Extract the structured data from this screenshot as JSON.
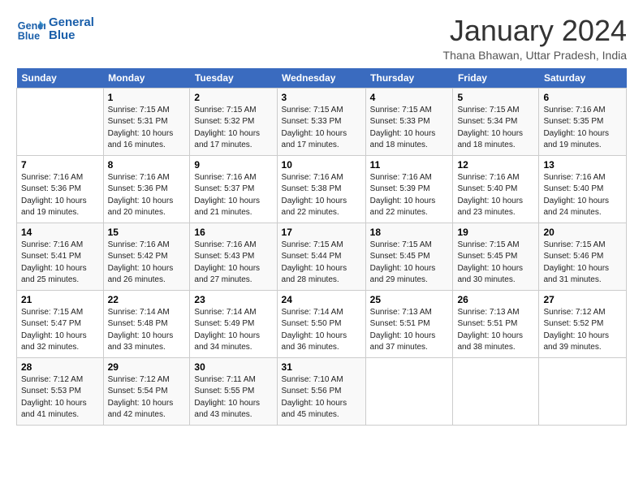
{
  "logo": {
    "line1": "General",
    "line2": "Blue"
  },
  "title": "January 2024",
  "subtitle": "Thana Bhawan, Uttar Pradesh, India",
  "header": {
    "days": [
      "Sunday",
      "Monday",
      "Tuesday",
      "Wednesday",
      "Thursday",
      "Friday",
      "Saturday"
    ]
  },
  "weeks": [
    [
      {
        "day": "",
        "sunrise": "",
        "sunset": "",
        "daylight": ""
      },
      {
        "day": "1",
        "sunrise": "7:15 AM",
        "sunset": "5:31 PM",
        "daylight": "10 hours and 16 minutes."
      },
      {
        "day": "2",
        "sunrise": "7:15 AM",
        "sunset": "5:32 PM",
        "daylight": "10 hours and 17 minutes."
      },
      {
        "day": "3",
        "sunrise": "7:15 AM",
        "sunset": "5:33 PM",
        "daylight": "10 hours and 17 minutes."
      },
      {
        "day": "4",
        "sunrise": "7:15 AM",
        "sunset": "5:33 PM",
        "daylight": "10 hours and 18 minutes."
      },
      {
        "day": "5",
        "sunrise": "7:15 AM",
        "sunset": "5:34 PM",
        "daylight": "10 hours and 18 minutes."
      },
      {
        "day": "6",
        "sunrise": "7:16 AM",
        "sunset": "5:35 PM",
        "daylight": "10 hours and 19 minutes."
      }
    ],
    [
      {
        "day": "7",
        "sunrise": "7:16 AM",
        "sunset": "5:36 PM",
        "daylight": "10 hours and 19 minutes."
      },
      {
        "day": "8",
        "sunrise": "7:16 AM",
        "sunset": "5:36 PM",
        "daylight": "10 hours and 20 minutes."
      },
      {
        "day": "9",
        "sunrise": "7:16 AM",
        "sunset": "5:37 PM",
        "daylight": "10 hours and 21 minutes."
      },
      {
        "day": "10",
        "sunrise": "7:16 AM",
        "sunset": "5:38 PM",
        "daylight": "10 hours and 22 minutes."
      },
      {
        "day": "11",
        "sunrise": "7:16 AM",
        "sunset": "5:39 PM",
        "daylight": "10 hours and 22 minutes."
      },
      {
        "day": "12",
        "sunrise": "7:16 AM",
        "sunset": "5:40 PM",
        "daylight": "10 hours and 23 minutes."
      },
      {
        "day": "13",
        "sunrise": "7:16 AM",
        "sunset": "5:40 PM",
        "daylight": "10 hours and 24 minutes."
      }
    ],
    [
      {
        "day": "14",
        "sunrise": "7:16 AM",
        "sunset": "5:41 PM",
        "daylight": "10 hours and 25 minutes."
      },
      {
        "day": "15",
        "sunrise": "7:16 AM",
        "sunset": "5:42 PM",
        "daylight": "10 hours and 26 minutes."
      },
      {
        "day": "16",
        "sunrise": "7:16 AM",
        "sunset": "5:43 PM",
        "daylight": "10 hours and 27 minutes."
      },
      {
        "day": "17",
        "sunrise": "7:15 AM",
        "sunset": "5:44 PM",
        "daylight": "10 hours and 28 minutes."
      },
      {
        "day": "18",
        "sunrise": "7:15 AM",
        "sunset": "5:45 PM",
        "daylight": "10 hours and 29 minutes."
      },
      {
        "day": "19",
        "sunrise": "7:15 AM",
        "sunset": "5:45 PM",
        "daylight": "10 hours and 30 minutes."
      },
      {
        "day": "20",
        "sunrise": "7:15 AM",
        "sunset": "5:46 PM",
        "daylight": "10 hours and 31 minutes."
      }
    ],
    [
      {
        "day": "21",
        "sunrise": "7:15 AM",
        "sunset": "5:47 PM",
        "daylight": "10 hours and 32 minutes."
      },
      {
        "day": "22",
        "sunrise": "7:14 AM",
        "sunset": "5:48 PM",
        "daylight": "10 hours and 33 minutes."
      },
      {
        "day": "23",
        "sunrise": "7:14 AM",
        "sunset": "5:49 PM",
        "daylight": "10 hours and 34 minutes."
      },
      {
        "day": "24",
        "sunrise": "7:14 AM",
        "sunset": "5:50 PM",
        "daylight": "10 hours and 36 minutes."
      },
      {
        "day": "25",
        "sunrise": "7:13 AM",
        "sunset": "5:51 PM",
        "daylight": "10 hours and 37 minutes."
      },
      {
        "day": "26",
        "sunrise": "7:13 AM",
        "sunset": "5:51 PM",
        "daylight": "10 hours and 38 minutes."
      },
      {
        "day": "27",
        "sunrise": "7:12 AM",
        "sunset": "5:52 PM",
        "daylight": "10 hours and 39 minutes."
      }
    ],
    [
      {
        "day": "28",
        "sunrise": "7:12 AM",
        "sunset": "5:53 PM",
        "daylight": "10 hours and 41 minutes."
      },
      {
        "day": "29",
        "sunrise": "7:12 AM",
        "sunset": "5:54 PM",
        "daylight": "10 hours and 42 minutes."
      },
      {
        "day": "30",
        "sunrise": "7:11 AM",
        "sunset": "5:55 PM",
        "daylight": "10 hours and 43 minutes."
      },
      {
        "day": "31",
        "sunrise": "7:10 AM",
        "sunset": "5:56 PM",
        "daylight": "10 hours and 45 minutes."
      },
      {
        "day": "",
        "sunrise": "",
        "sunset": "",
        "daylight": ""
      },
      {
        "day": "",
        "sunrise": "",
        "sunset": "",
        "daylight": ""
      },
      {
        "day": "",
        "sunrise": "",
        "sunset": "",
        "daylight": ""
      }
    ]
  ]
}
